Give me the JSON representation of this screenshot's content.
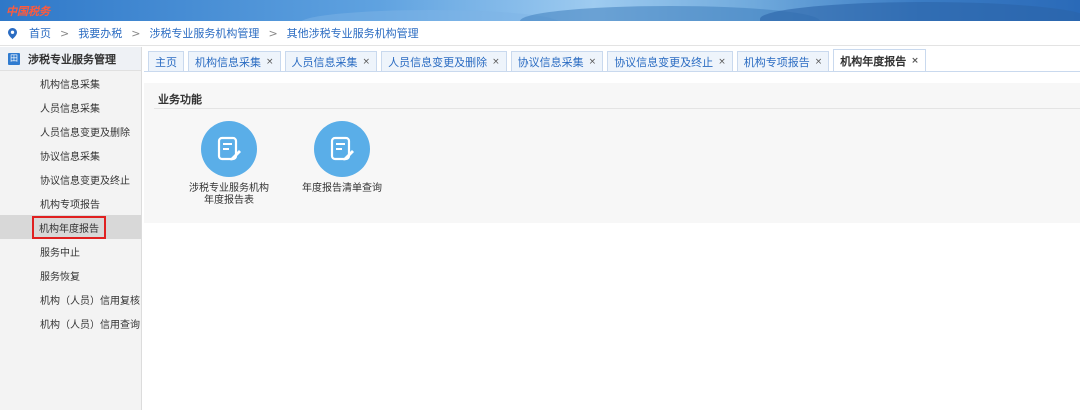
{
  "banner": {
    "brand": "中国税务"
  },
  "breadcrumb": {
    "items": [
      "首页",
      "我要办税",
      "涉税专业服务机构管理",
      "其他涉税专业服务机构管理"
    ],
    "separator": ">"
  },
  "sidebar": {
    "header": "涉税专业服务管理",
    "header_icon_text": "田",
    "items": [
      {
        "label": "机构信息采集"
      },
      {
        "label": "人员信息采集"
      },
      {
        "label": "人员信息变更及删除"
      },
      {
        "label": "协议信息采集"
      },
      {
        "label": "协议信息变更及终止"
      },
      {
        "label": "机构专项报告"
      },
      {
        "label": "机构年度报告"
      },
      {
        "label": "服务中止"
      },
      {
        "label": "服务恢复"
      },
      {
        "label": "机构（人员）信用复核"
      },
      {
        "label": "机构（人员）信用查询"
      }
    ],
    "active_index": 6
  },
  "tabs": [
    {
      "label": "主页",
      "closable": false
    },
    {
      "label": "机构信息采集",
      "closable": true
    },
    {
      "label": "人员信息采集",
      "closable": true
    },
    {
      "label": "人员信息变更及删除",
      "closable": true
    },
    {
      "label": "协议信息采集",
      "closable": true
    },
    {
      "label": "协议信息变更及终止",
      "closable": true
    },
    {
      "label": "机构专项报告",
      "closable": true
    },
    {
      "label": "机构年度报告",
      "closable": true
    }
  ],
  "active_tab_index": 7,
  "content": {
    "section_title": "业务功能",
    "functions": [
      {
        "label_line1": "涉税专业服务机构",
        "label_line2": "年度报告表",
        "icon": "edit-document-icon"
      },
      {
        "label_line1": "年度报告清单查询",
        "label_line2": "",
        "icon": "edit-document-icon"
      }
    ]
  },
  "colors": {
    "link": "#2b6cc2",
    "icon_circle": "#5aaee8",
    "highlight_border": "#e02020",
    "sidebar_bg": "#f3f3f3"
  }
}
